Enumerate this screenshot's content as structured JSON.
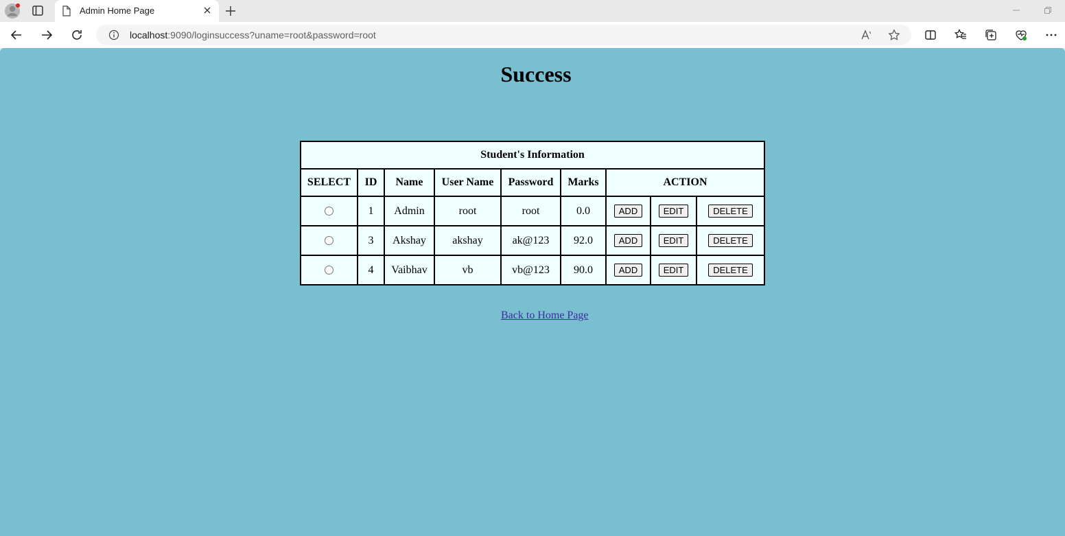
{
  "browser": {
    "tab_title": "Admin Home Page",
    "url_host": "localhost",
    "url_rest": ":9090/loginsuccess?uname=root&password=root"
  },
  "page": {
    "heading": "Success",
    "link_text": "Back to Home Page"
  },
  "table": {
    "caption": "Student's Information",
    "headers": [
      "SELECT",
      "ID",
      "Name",
      "User Name",
      "Password",
      "Marks",
      "ACTION"
    ],
    "actions": [
      "ADD",
      "EDIT",
      "DELETE"
    ],
    "rows": [
      {
        "id": "1",
        "name": "Admin",
        "username": "root",
        "password": "root",
        "marks": "0.0"
      },
      {
        "id": "3",
        "name": "Akshay",
        "username": "akshay",
        "password": "ak@123",
        "marks": "92.0"
      },
      {
        "id": "4",
        "name": "Vaibhav",
        "username": "vb",
        "password": "vb@123",
        "marks": "90.0"
      }
    ]
  },
  "colors": {
    "page_background": "#79bfd0",
    "table_background": "#f0ffff",
    "link": "#3a2e9e"
  }
}
